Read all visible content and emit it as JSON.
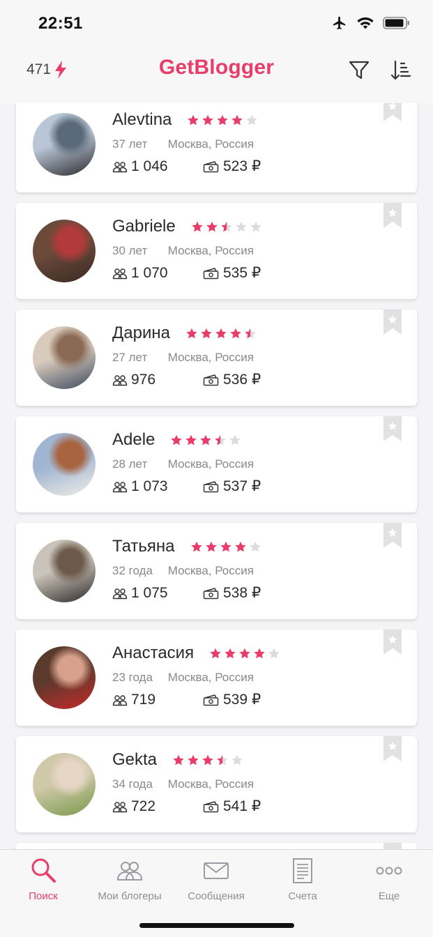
{
  "status_bar": {
    "time": "22:51"
  },
  "header": {
    "credits": "471",
    "logo": "GetBlogger"
  },
  "colors": {
    "accent": "#e83d6a",
    "star_empty": "#dcdcdc",
    "text_muted": "#888888"
  },
  "bloggers": [
    {
      "name": "Alevtina",
      "age": "37 лет",
      "location": "Москва, Россия",
      "subscribers": "1 046",
      "price": "523 ₽",
      "rating": 4,
      "avatar_colors": [
        "#b9c6d6",
        "#5a6a7a",
        "#2b2a2e"
      ]
    },
    {
      "name": "Gabriele",
      "age": "30 лет",
      "location": "Москва, Россия",
      "subscribers": "1 070",
      "price": "535 ₽",
      "rating": 2.5,
      "avatar_colors": [
        "#6b4a3a",
        "#b23a3a",
        "#3a2a24"
      ]
    },
    {
      "name": "Дарина",
      "age": "27 лет",
      "location": "Москва, Россия",
      "subscribers": "976",
      "price": "536 ₽",
      "rating": 4.5,
      "avatar_colors": [
        "#d8cbbd",
        "#8a6a55",
        "#3f4a5e"
      ]
    },
    {
      "name": "Adele",
      "age": "28 лет",
      "location": "Москва, Россия",
      "subscribers": "1 073",
      "price": "537 ₽",
      "rating": 3.5,
      "avatar_colors": [
        "#9fb5d1",
        "#a8633f",
        "#f0ece6"
      ]
    },
    {
      "name": "Татьяна",
      "age": "32 года",
      "location": "Москва, Россия",
      "subscribers": "1 075",
      "price": "538 ₽",
      "rating": 4,
      "avatar_colors": [
        "#c9c3b9",
        "#6d5a4c",
        "#2e2a28"
      ]
    },
    {
      "name": "Анастасия",
      "age": "23 года",
      "location": "Москва, Россия",
      "subscribers": "719",
      "price": "539 ₽",
      "rating": 4,
      "avatar_colors": [
        "#5a3a2c",
        "#d6a08a",
        "#c42a2a"
      ]
    },
    {
      "name": "Gekta",
      "age": "34 года",
      "location": "Москва, Россия",
      "subscribers": "722",
      "price": "541 ₽",
      "rating": 3.5,
      "avatar_colors": [
        "#cfc8a9",
        "#e6d6c5",
        "#7a9a4a"
      ]
    }
  ],
  "tabs": [
    {
      "label": "Поиск",
      "icon": "search-icon",
      "active": true
    },
    {
      "label": "Мои блогеры",
      "icon": "bloggers-icon",
      "active": false
    },
    {
      "label": "Сообщения",
      "icon": "mail-icon",
      "active": false
    },
    {
      "label": "Счета",
      "icon": "invoice-icon",
      "active": false
    },
    {
      "label": "Еще",
      "icon": "more-icon",
      "active": false
    }
  ]
}
